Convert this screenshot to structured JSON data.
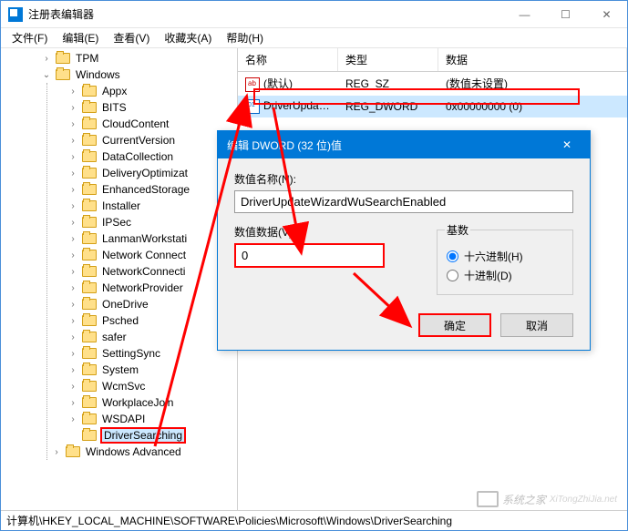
{
  "window": {
    "title": "注册表编辑器"
  },
  "menu": {
    "file": "文件(F)",
    "edit": "编辑(E)",
    "view": "查看(V)",
    "favorites": "收藏夹(A)",
    "help": "帮助(H)"
  },
  "tree": {
    "tpm": "TPM",
    "windows": "Windows",
    "children": [
      "Appx",
      "BITS",
      "CloudContent",
      "CurrentVersion",
      "DataCollection",
      "DeliveryOptimizat",
      "EnhancedStorage",
      "Installer",
      "IPSec",
      "LanmanWorkstati",
      "Network Connect",
      "NetworkConnecti",
      "NetworkProvider",
      "OneDrive",
      "Psched",
      "safer",
      "SettingSync",
      "System",
      "WcmSvc",
      "WorkplaceJoin",
      "WSDAPI"
    ],
    "driver_searching": "DriverSearching",
    "windows_advanced": "Windows Advanced"
  },
  "list": {
    "headers": {
      "name": "名称",
      "type": "类型",
      "data": "数据"
    },
    "rows": [
      {
        "name": "(默认)",
        "type": "REG_SZ",
        "data": "(数值未设置)",
        "icon": "ab"
      },
      {
        "name": "DriverUpdate...",
        "type": "REG_DWORD",
        "data": "0x00000000 (0)",
        "icon": "dw"
      }
    ]
  },
  "dialog": {
    "title": "编辑 DWORD (32 位)值",
    "name_label": "数值名称(N):",
    "name_value": "DriverUpdateWizardWuSearchEnabled",
    "data_label": "数值数据(V):",
    "data_value": "0",
    "base_label": "基数",
    "radio_hex": "十六进制(H)",
    "radio_dec": "十进制(D)",
    "ok": "确定",
    "cancel": "取消"
  },
  "statusbar": "计算机\\HKEY_LOCAL_MACHINE\\SOFTWARE\\Policies\\Microsoft\\Windows\\DriverSearching",
  "watermark": "系统之家"
}
